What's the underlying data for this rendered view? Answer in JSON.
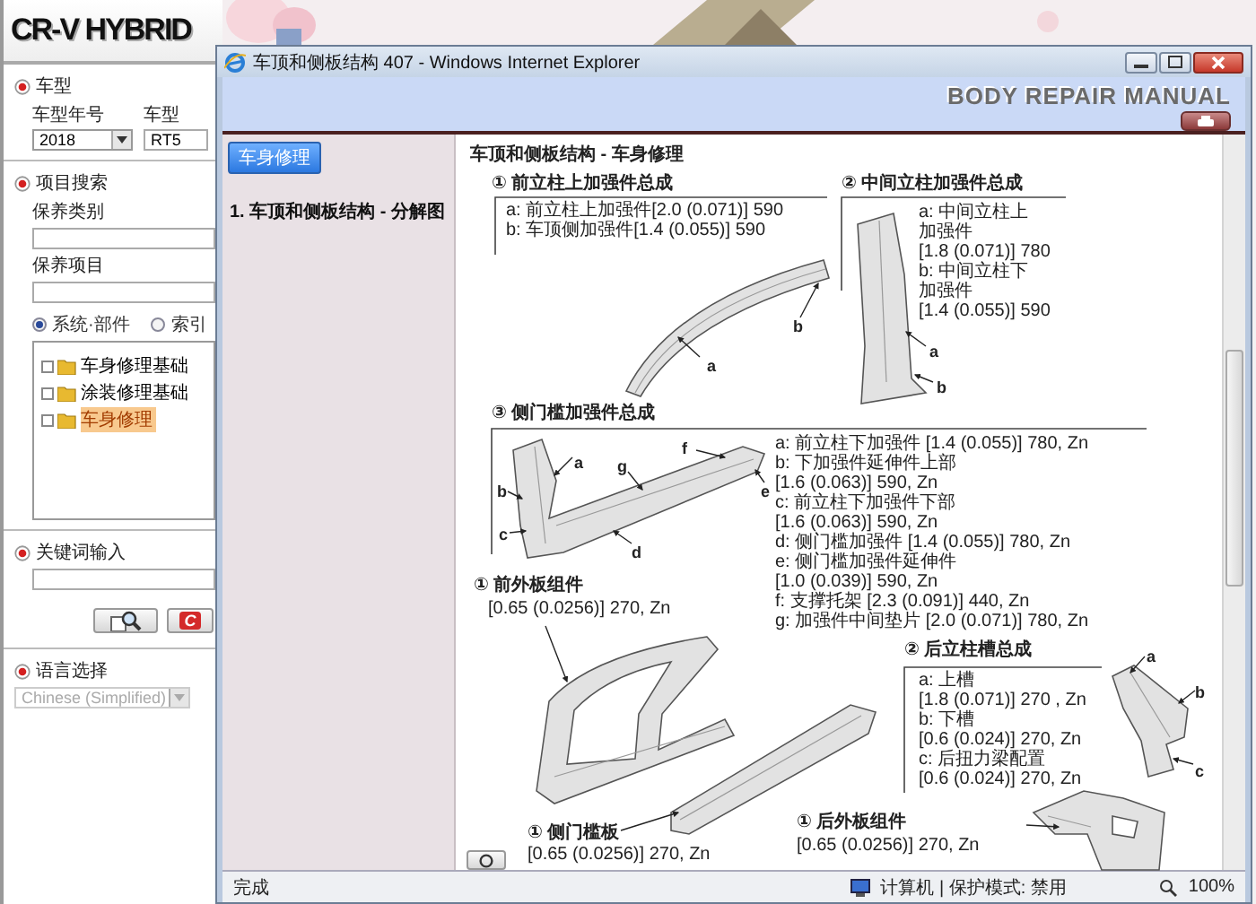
{
  "left_panel": {
    "logo": "CR-V HYBRID",
    "vehicle": {
      "heading": "车型",
      "year_label": "车型年号",
      "year_value": "2018",
      "type_label": "车型",
      "type_value": "RT5"
    },
    "search": {
      "heading": "项目搜索",
      "category_label": "保养类别",
      "item_label": "保养项目",
      "modes": [
        {
          "label": "系统·部件",
          "selected": true
        },
        {
          "label": "索引",
          "selected": false
        }
      ],
      "tree": [
        {
          "label": "车身修理基础",
          "selected": false
        },
        {
          "label": "涂装修理基础",
          "selected": false
        },
        {
          "label": "车身修理",
          "selected": true
        }
      ]
    },
    "keyword": {
      "heading": "关键词输入",
      "buttons": [
        {
          "kind": "search"
        },
        {
          "kind": "clear",
          "label": "C"
        }
      ]
    },
    "language": {
      "heading": "语言选择",
      "value": "Chinese (Simplified)",
      "disabled": true
    }
  },
  "browser": {
    "title": "车顶和侧板结构 407 - Windows Internet Explorer",
    "banner": "BODY REPAIR MANUAL",
    "nav": {
      "tab": "车身修理",
      "items": [
        "1. 车顶和侧板结构 - 分解图"
      ]
    },
    "content": {
      "heading": "车顶和侧板结构 - 车身修理",
      "diagrams": [
        {
          "kind": "a_pillar",
          "title": "① 前立柱上加强件总成",
          "specs": [
            "a: 前立柱上加强件[2.0 (0.071)] 590",
            "b: 车顶侧加强件[1.4 (0.055)] 590"
          ],
          "callouts": [
            "a",
            "b"
          ]
        },
        {
          "kind": "b_pillar",
          "title": "② 中间立柱加强件总成",
          "specs": [
            "a: 中间立柱上",
            "加强件",
            "[1.8 (0.071)] 780",
            "b: 中间立柱下",
            "加强件",
            "[1.4 (0.055)] 590"
          ],
          "callouts": [
            "a",
            "b"
          ]
        },
        {
          "kind": "sill_reinforcement",
          "title": "③ 侧门槛加强件总成",
          "specs": [
            "a: 前立柱下加强件 [1.4 (0.055)] 780, Zn",
            "b: 下加强件延伸件上部",
            "[1.6 (0.063)] 590, Zn",
            "c: 前立柱下加强件下部",
            "[1.6 (0.063)] 590, Zn",
            "d: 侧门槛加强件 [1.4 (0.055)] 780, Zn",
            "e: 侧门槛加强件延伸件",
            "[1.0 (0.039)] 590, Zn",
            "f: 支撑托架 [2.3 (0.091)] 440, Zn",
            "g: 加强件中间垫片 [2.0 (0.071)] 780, Zn"
          ],
          "callouts": [
            "a",
            "b",
            "c",
            "d",
            "e",
            "f",
            "g"
          ]
        },
        {
          "kind": "front_outer",
          "title": "① 前外板组件",
          "specs": [
            "[0.65 (0.0256)] 270, Zn"
          ]
        },
        {
          "kind": "c_pillar",
          "title": "② 后立柱槽总成",
          "specs": [
            "a: 上槽",
            "[1.8 (0.071)] 270 , Zn",
            "b: 下槽",
            "[0.6 (0.024)] 270, Zn",
            "c: 后扭力梁配置",
            "[0.6 (0.024)] 270, Zn"
          ],
          "callouts": [
            "a",
            "b",
            "c"
          ]
        },
        {
          "kind": "side_sill",
          "title": "① 侧门槛板",
          "specs": [
            "[0.65 (0.0256)] 270, Zn"
          ]
        },
        {
          "kind": "rear_outer",
          "title": "① 后外板组件",
          "specs": [
            "[0.65 (0.0256)] 270, Zn"
          ]
        }
      ]
    },
    "status_bar": {
      "text": "完成",
      "zone": "计算机 | 保护模式: 禁用",
      "zoom": "100%"
    }
  }
}
